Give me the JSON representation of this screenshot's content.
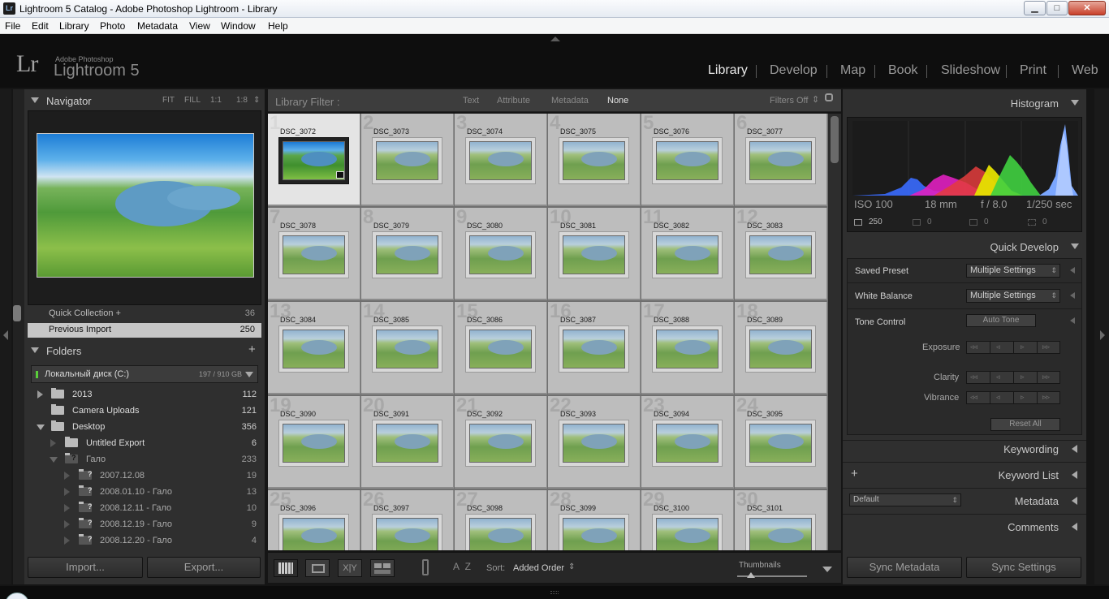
{
  "window": {
    "title": "Lightroom 5 Catalog - Adobe Photoshop Lightroom - Library",
    "app_icon": "Lr",
    "minimize_glyph": "▁",
    "maximize_glyph": "□",
    "close_glyph": "✕"
  },
  "menu": [
    "File",
    "Edit",
    "Library",
    "Photo",
    "Metadata",
    "View",
    "Window",
    "Help"
  ],
  "identity": {
    "logo": "Lr",
    "brand_small": "Adobe Photoshop",
    "brand_big": "Lightroom 5"
  },
  "modules": [
    {
      "label": "Library",
      "active": true
    },
    {
      "label": "Develop",
      "active": false
    },
    {
      "label": "Map",
      "active": false
    },
    {
      "label": "Book",
      "active": false
    },
    {
      "label": "Slideshow",
      "active": false
    },
    {
      "label": "Print",
      "active": false
    },
    {
      "label": "Web",
      "active": false
    }
  ],
  "navigator": {
    "title": "Navigator",
    "options": [
      "FIT",
      "FILL",
      "1:1",
      "1:8"
    ]
  },
  "collections": [
    {
      "label": "Quick Collection +",
      "count": "36",
      "selected": false
    },
    {
      "label": "Previous Import",
      "count": "250",
      "selected": true
    }
  ],
  "folders": {
    "title": "Folders",
    "add_symbol": "+",
    "disk": {
      "label": "Локальный диск (C:)",
      "usage": "197 / 910 GB"
    },
    "rows": [
      {
        "label": "2013",
        "count": "112",
        "level": 0,
        "expand": "collapsed",
        "missing": false
      },
      {
        "label": "Camera Uploads",
        "count": "121",
        "level": 0,
        "expand": "none",
        "missing": false
      },
      {
        "label": "Desktop",
        "count": "356",
        "level": 0,
        "expand": "expanded",
        "missing": false
      },
      {
        "label": "Untitled Export",
        "count": "6",
        "level": 1,
        "expand": "collapsed",
        "missing": false
      },
      {
        "label": "Гало",
        "count": "233",
        "level": 1,
        "expand": "expanded",
        "missing": true
      },
      {
        "label": "2007.12.08",
        "count": "19",
        "level": 2,
        "expand": "collapsed",
        "missing": true
      },
      {
        "label": "2008.01.10 - Гало",
        "count": "13",
        "level": 2,
        "expand": "collapsed",
        "missing": true
      },
      {
        "label": "2008.12.11 - Гало",
        "count": "10",
        "level": 2,
        "expand": "collapsed",
        "missing": true
      },
      {
        "label": "2008.12.19 - Гало",
        "count": "9",
        "level": 2,
        "expand": "collapsed",
        "missing": true
      },
      {
        "label": "2008.12.20 - Гало",
        "count": "4",
        "level": 2,
        "expand": "collapsed",
        "missing": true
      }
    ]
  },
  "left_buttons": {
    "import": "Import...",
    "export": "Export..."
  },
  "filter_bar": {
    "title": "Library Filter :",
    "options": [
      "Text",
      "Attribute",
      "Metadata",
      "None"
    ],
    "active": "None",
    "filters_status": "Filters Off"
  },
  "grid": {
    "selected_index": 0,
    "cells": [
      {
        "num": "1",
        "name": "DSC_3072"
      },
      {
        "num": "2",
        "name": "DSC_3073"
      },
      {
        "num": "3",
        "name": "DSC_3074"
      },
      {
        "num": "4",
        "name": "DSC_3075"
      },
      {
        "num": "5",
        "name": "DSC_3076"
      },
      {
        "num": "6",
        "name": "DSC_3077"
      },
      {
        "num": "7",
        "name": "DSC_3078"
      },
      {
        "num": "8",
        "name": "DSC_3079"
      },
      {
        "num": "9",
        "name": "DSC_3080"
      },
      {
        "num": "10",
        "name": "DSC_3081"
      },
      {
        "num": "11",
        "name": "DSC_3082"
      },
      {
        "num": "12",
        "name": "DSC_3083"
      },
      {
        "num": "13",
        "name": "DSC_3084"
      },
      {
        "num": "14",
        "name": "DSC_3085"
      },
      {
        "num": "15",
        "name": "DSC_3086"
      },
      {
        "num": "16",
        "name": "DSC_3087"
      },
      {
        "num": "17",
        "name": "DSC_3088"
      },
      {
        "num": "18",
        "name": "DSC_3089"
      },
      {
        "num": "19",
        "name": "DSC_3090"
      },
      {
        "num": "20",
        "name": "DSC_3091"
      },
      {
        "num": "21",
        "name": "DSC_3092"
      },
      {
        "num": "22",
        "name": "DSC_3093"
      },
      {
        "num": "23",
        "name": "DSC_3094"
      },
      {
        "num": "24",
        "name": "DSC_3095"
      },
      {
        "num": "25",
        "name": "DSC_3096"
      },
      {
        "num": "26",
        "name": "DSC_3097"
      },
      {
        "num": "27",
        "name": "DSC_3098"
      },
      {
        "num": "28",
        "name": "DSC_3099"
      },
      {
        "num": "29",
        "name": "DSC_3100"
      },
      {
        "num": "30",
        "name": "DSC_3101"
      }
    ]
  },
  "toolbar": {
    "sort_label": "Sort:",
    "sort_value": "Added Order",
    "sort_arrows": "⇕",
    "compare_label": "X|Y",
    "az_glyph": "A Z",
    "thumbnails_label": "Thumbnails",
    "thumbnails_size_fraction": 0.2
  },
  "histogram": {
    "title": "Histogram",
    "iso": "ISO 100",
    "focal": "18 mm",
    "aperture": "f / 8.0",
    "shutter": "1/250 sec",
    "info_values": [
      "250",
      "0",
      "0",
      "0"
    ]
  },
  "quick_develop": {
    "title": "Quick Develop",
    "saved_preset": {
      "label": "Saved Preset",
      "value": "Multiple Settings"
    },
    "white_balance": {
      "label": "White Balance",
      "value": "Multiple Settings"
    },
    "tone_control": {
      "label": "Tone Control",
      "auto_tone": "Auto Tone"
    },
    "adjustments": [
      "Exposure",
      "Clarity",
      "Vibrance"
    ],
    "arrow_glyphs": [
      "◃◃",
      "◃",
      "▹",
      "▹▹"
    ],
    "reset": "Reset All"
  },
  "right_sections": {
    "keywording": "Keywording",
    "keyword_list": "Keyword List",
    "keyword_add": "+",
    "metadata": "Metadata",
    "metadata_preset": "Default",
    "comments": "Comments"
  },
  "right_buttons": {
    "sync_metadata": "Sync Metadata",
    "sync_settings": "Sync Settings"
  },
  "colors": {
    "panel": "#2f2f2f",
    "grid_cell": "#bdbdbd",
    "grid_cell_selected": "#e4e4e4",
    "active_module": "#e8e8e8",
    "histogram_blue": "#3a6cff",
    "histogram_magenta": "#e020c0",
    "histogram_yellow": "#e6e000",
    "histogram_green": "#40d040"
  }
}
